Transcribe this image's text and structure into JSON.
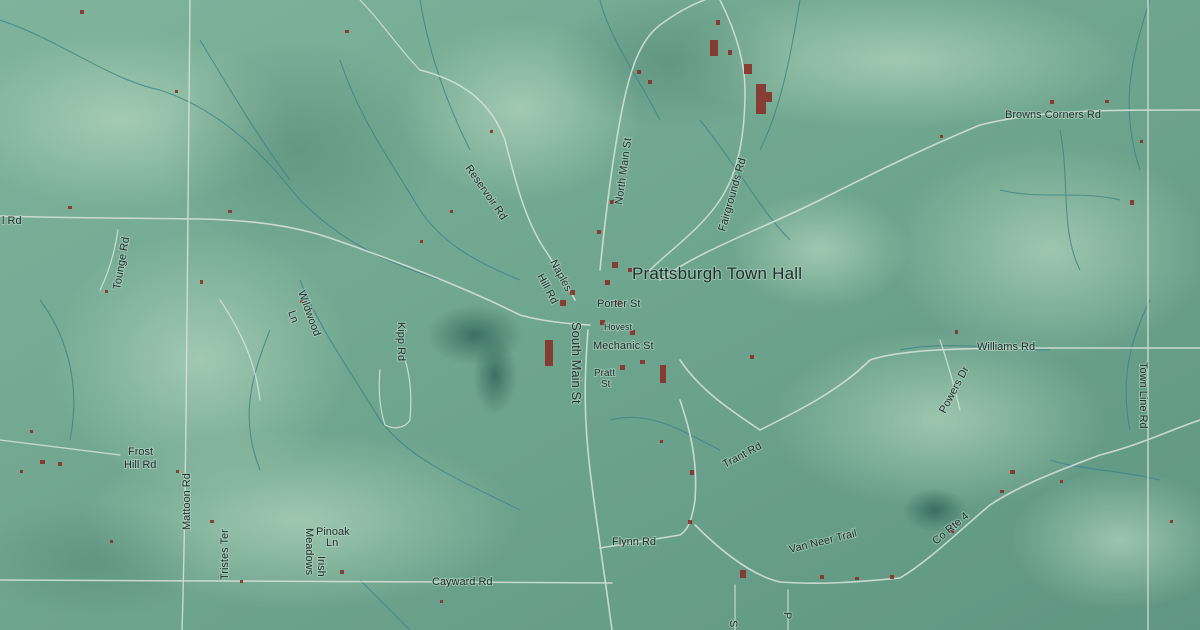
{
  "map": {
    "kind": "shaded-relief topographic map",
    "colors": {
      "terrain": "#6ea58f",
      "terrain_light": "#9ec9b0",
      "terrain_dark": "#3f7768",
      "road": "#d9e4dc",
      "stream": "#3d8386",
      "building": "#8a2a22",
      "label": "#1c2f2e"
    },
    "labels": {
      "town_hall": "Prattsburgh Town Hall",
      "browns_corners_rd": "Browns Corners Rd",
      "williams_rd": "Williams Rd",
      "town_line_rd": "Town Line Rd",
      "powers_dr": "Powers Dr",
      "trant_rd": "Trant Rd",
      "co_rte_4": "Co Rte 4",
      "van_neer_trail": "Van Neer Trail",
      "flynn_rd": "Flynn Rd",
      "cayward_rd": "Cayward Rd",
      "south_main_st": "South Main St",
      "north_main_st": "North Main St",
      "fairgrounds_rd": "Fairgrounds Rd",
      "reservoir_rd": "Reservoir Rd",
      "naples_hill_rd_1": "Naples",
      "naples_hill_rd_2": "Hill Rd",
      "porter_st": "Porter St",
      "mechanic_st": "Mechanic St",
      "hovest": "Hovest",
      "pratt_st_1": "Pratt",
      "pratt_st_2": "St",
      "kipp_rd": "Kipp Rd",
      "wildwood_ln_1": "Wildwood",
      "wildwood_ln_2": "Ln",
      "tounge_rd": "Tounge Rd",
      "l_rd": "l Rd",
      "frost_hill_rd_1": "Frost",
      "frost_hill_rd_2": "Hill Rd",
      "mattoon_rd": "Mattoon Rd",
      "tristes_ter": "Tristes Ter",
      "pinoak_ln_1": "Pinoak",
      "pinoak_ln_2": "Ln",
      "irish_meadows_1": "Irish",
      "irish_meadows_2": "Meadows",
      "s_fragment": "S",
      "p_fragment": "P"
    }
  }
}
